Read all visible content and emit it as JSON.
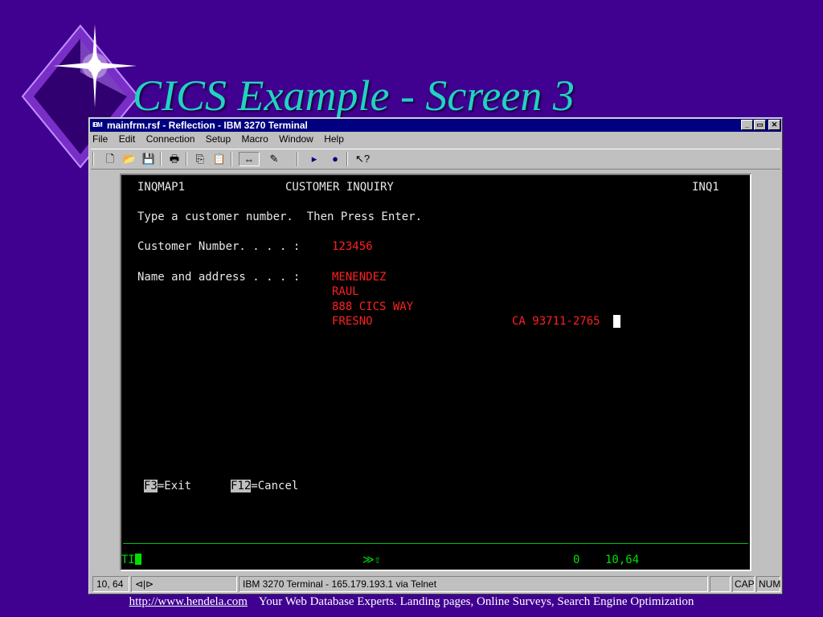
{
  "slide": {
    "title": "CICS Example - Screen 3",
    "footer_link": "http://www.hendela.com",
    "footer_text": "Your Web Database Experts. Landing pages, Online Surveys, Search Engine Optimization"
  },
  "window": {
    "app_icon": "IBM",
    "title": "mainfrm.rsf - Reflection - IBM 3270 Terminal",
    "controls": {
      "minimize": "_",
      "restore": "▭",
      "close": "✕"
    }
  },
  "menu": [
    "File",
    "Edit",
    "Connection",
    "Setup",
    "Macro",
    "Window",
    "Help"
  ],
  "toolbar": [
    {
      "name": "new-icon",
      "glyph": "🗋"
    },
    {
      "name": "open-icon",
      "glyph": "📂"
    },
    {
      "name": "save-icon",
      "glyph": "💾"
    },
    {
      "name": "print-icon",
      "glyph": "🖶"
    },
    {
      "name": "copy-icon",
      "glyph": "⎘"
    },
    {
      "name": "paste-icon",
      "glyph": "📋"
    },
    {
      "name": "connect-icon",
      "glyph": "⇔"
    },
    {
      "name": "macro-icon",
      "glyph": "✎"
    },
    {
      "name": "play-icon",
      "glyph": "▸"
    },
    {
      "name": "record-icon",
      "glyph": "●"
    },
    {
      "name": "context-help-icon",
      "glyph": "↖?"
    }
  ],
  "terminal": {
    "map_name": "INQMAP1",
    "screen_title": "CUSTOMER INQUIRY",
    "trans_id": "INQ1",
    "instructions": "Type a customer number.  Then Press Enter.",
    "cust_label": "Customer Number. . . . :",
    "cust_number": "123456",
    "name_label": "Name and address . . . :",
    "last_name": "MENENDEZ",
    "first_name": "RAUL",
    "street": "888 CICS WAY",
    "city": "FRESNO",
    "state_zip": "CA 93711-2765",
    "f3_key": "F3",
    "f3_label": "=Exit",
    "f12_key": "F12",
    "f12_label": "=Cancel",
    "oia_left": "TI",
    "oia_mid": "≫⇧",
    "oia_count": "0",
    "oia_cursor": "10,64"
  },
  "status": {
    "cursor": "10, 64",
    "connection": "IBM 3270 Terminal - 165.179.193.1 via Telnet",
    "cap": "CAP",
    "num": "NUM"
  },
  "colors": {
    "background": "#400090",
    "title": "#21d3c0",
    "titlebar": "#000080",
    "field": "#ff2020",
    "oia": "#00e000"
  }
}
